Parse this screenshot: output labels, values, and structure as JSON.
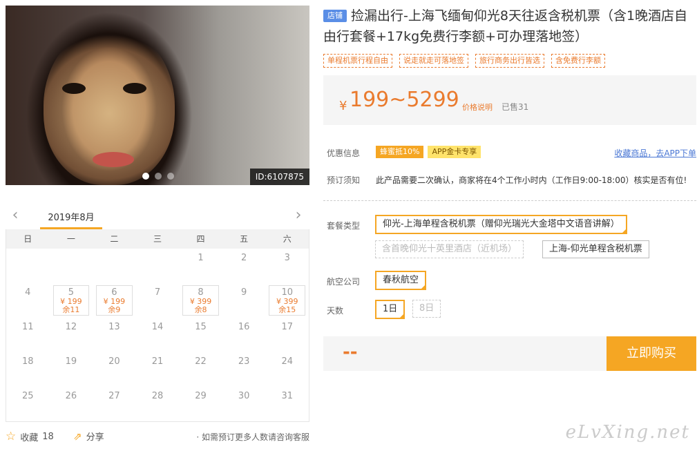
{
  "photo": {
    "id_label": "ID:6107875",
    "slide_count": 3,
    "active_slide": 1
  },
  "calendar": {
    "month_label": "2019年8月",
    "weekdays": [
      "日",
      "一",
      "二",
      "三",
      "四",
      "五",
      "六"
    ],
    "days": [
      {
        "d": ""
      },
      {
        "d": ""
      },
      {
        "d": ""
      },
      {
        "d": ""
      },
      {
        "d": "1"
      },
      {
        "d": "2"
      },
      {
        "d": "3"
      },
      {
        "d": "4"
      },
      {
        "d": "5",
        "price": "¥ 199",
        "stock": "余11"
      },
      {
        "d": "6",
        "price": "¥ 199",
        "stock": "余9"
      },
      {
        "d": "7"
      },
      {
        "d": "8",
        "price": "¥ 399",
        "stock": "余8"
      },
      {
        "d": "9"
      },
      {
        "d": "10",
        "price": "¥ 399",
        "stock": "余15"
      },
      {
        "d": "11"
      },
      {
        "d": "12"
      },
      {
        "d": "13"
      },
      {
        "d": "14"
      },
      {
        "d": "15"
      },
      {
        "d": "16"
      },
      {
        "d": "17"
      },
      {
        "d": "18"
      },
      {
        "d": "19"
      },
      {
        "d": "20"
      },
      {
        "d": "21"
      },
      {
        "d": "22"
      },
      {
        "d": "23"
      },
      {
        "d": "24"
      },
      {
        "d": "25"
      },
      {
        "d": "26"
      },
      {
        "d": "27"
      },
      {
        "d": "28"
      },
      {
        "d": "29"
      },
      {
        "d": "30"
      },
      {
        "d": "31"
      }
    ]
  },
  "social": {
    "collect_label": "收藏",
    "collect_count": "18",
    "share_label": "分享",
    "note": "· 如需预订更多人数请咨询客服"
  },
  "product": {
    "shop_badge": "店铺",
    "title": "捡漏出行-上海飞缅甸仰光8天往返含税机票（含1晚酒店自由行套餐+17kg免费行李额+可办理落地签）",
    "tags": [
      "单程机票行程自由",
      "说走就走可落地签",
      "旅行商务出行皆选",
      "含免费行李额"
    ],
    "currency": "¥",
    "price_range": "199~5299",
    "price_explain": "价格说明",
    "sold": "已售31"
  },
  "info": {
    "promo_label": "优惠信息",
    "promos": [
      "蜂蜜抵10%",
      "APP金卡专享"
    ],
    "collect_link": "收藏商品，去APP下单",
    "notice_label": "预订须知",
    "notice_text": "此产品需要二次确认，商家将在4个工作小时内（工作日9:00-18:00）核实是否有位!"
  },
  "options": {
    "package_label": "套餐类型",
    "packages": [
      "仰光-上海单程含税机票（赠仰光瑞光大金塔中文语音讲解）",
      "含首晚仰光十英里酒店（近机场）",
      "上海-仰光单程含税机票"
    ],
    "airline_label": "航空公司",
    "airline": "春秋航空",
    "days_label": "天数",
    "days": [
      "1日",
      "8日"
    ]
  },
  "purchase": {
    "total": "--",
    "buy_label": "立即购买"
  },
  "watermark": "eLvXing.net"
}
